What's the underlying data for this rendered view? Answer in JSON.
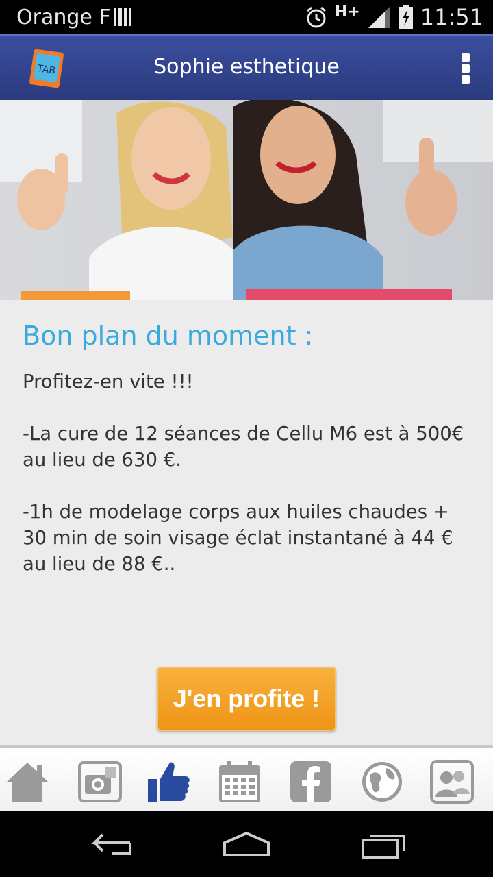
{
  "status_bar": {
    "carrier": "Orange F",
    "network": "H+",
    "time": "11:51",
    "icons": [
      "sim-signal-icon",
      "alarm-icon",
      "network-signal-icon",
      "battery-charging-icon"
    ]
  },
  "app_bar": {
    "logo_text": "TAB",
    "title": "Sophie esthetique",
    "menu_icon": "overflow-menu-icon"
  },
  "hero": {
    "icon": "hero-banner-image"
  },
  "content": {
    "headline": "Bon plan du moment :",
    "paragraphs": [
      "Profitez-en vite !!!",
      "-La cure de 12 séances de Cellu M6 est à 500€ au lieu de 630 €.",
      "-1h de modelage corps aux huiles chaudes + 30 min de soin visage éclat instantané à 44 € au lieu de 88 €.."
    ],
    "cta_label": "J'en profite !"
  },
  "tab_bar": {
    "tabs": [
      {
        "icon": "home-icon",
        "active": false
      },
      {
        "icon": "photos-icon",
        "active": false
      },
      {
        "icon": "thumbs-up-icon",
        "active": true
      },
      {
        "icon": "calendar-icon",
        "active": false
      },
      {
        "icon": "facebook-icon",
        "active": false
      },
      {
        "icon": "globe-icon",
        "active": false
      },
      {
        "icon": "contacts-icon",
        "active": false
      }
    ]
  },
  "nav_bar": {
    "buttons": [
      "back-icon",
      "home-nav-icon",
      "recent-apps-icon"
    ]
  },
  "colors": {
    "app_bar": "#2f4187",
    "headline": "#3aa9dd",
    "cta": "#f3a128",
    "active_tab": "#2a4aa0",
    "inactive_tab": "#9a9a9a"
  }
}
